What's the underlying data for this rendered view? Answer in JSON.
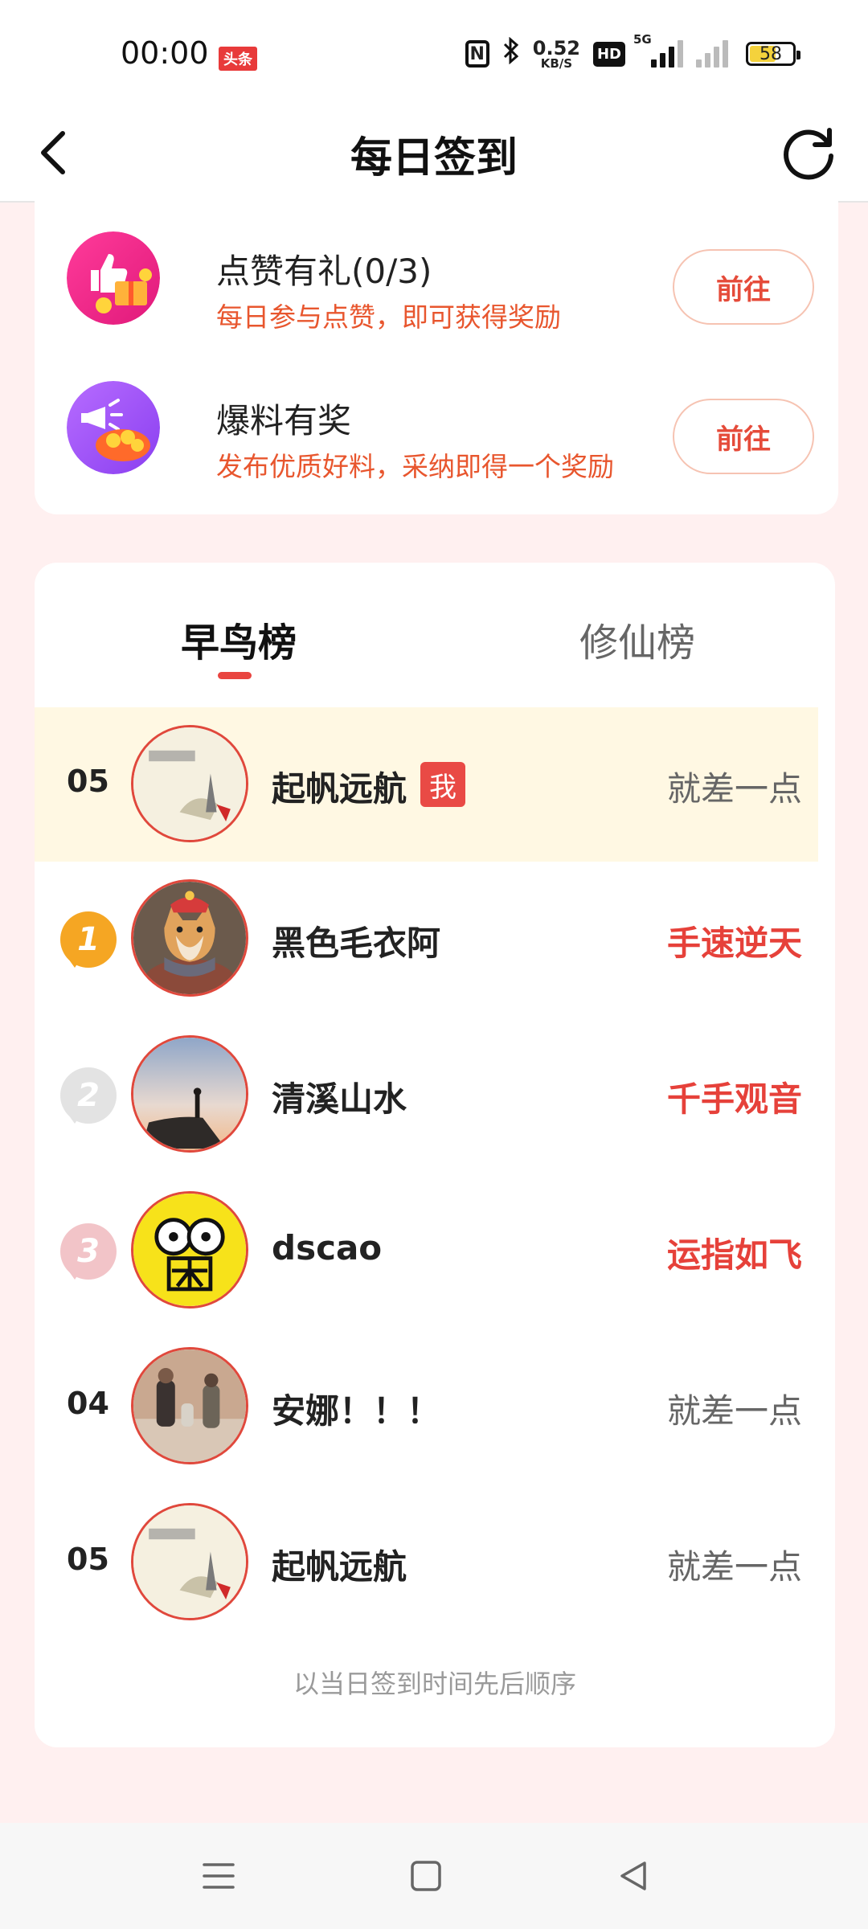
{
  "status_bar": {
    "time": "00:00",
    "news_badge": "头条",
    "nfc": "N",
    "speed_value": "0.52",
    "speed_unit": "KB/S",
    "hd_label": "HD",
    "network": "5G",
    "battery": "58"
  },
  "header": {
    "title": "每日签到"
  },
  "tasks": [
    {
      "title": "点赞有礼(0/3)",
      "desc": "每日参与点赞，即可获得奖励",
      "button": "前往",
      "icon": "like-gift-icon"
    },
    {
      "title": "爆料有奖",
      "desc": "发布优质好料，采纳即得一个奖励",
      "button": "前往",
      "icon": "megaphone-coins-icon"
    }
  ],
  "ranking": {
    "tabs": [
      "早鸟榜",
      "修仙榜"
    ],
    "active_tab": 0,
    "me_badge": "我",
    "rows": [
      {
        "rank": "05",
        "name": "起帆远航",
        "status": "就差一点",
        "is_me": true
      },
      {
        "rank": "1",
        "name": "黑色毛衣阿",
        "status": "手速逆天",
        "medal": "gold"
      },
      {
        "rank": "2",
        "name": "清溪山水",
        "status": "千手观音",
        "medal": "silver"
      },
      {
        "rank": "3",
        "name": "dscao",
        "status": "运指如飞",
        "medal": "bronze"
      },
      {
        "rank": "04",
        "name": "安娜！！！",
        "status": "就差一点"
      },
      {
        "rank": "05",
        "name": "起帆远航",
        "status": "就差一点"
      }
    ],
    "footer_note": "以当日签到时间先后顺序"
  },
  "colors": {
    "accent": "#e94540",
    "orange_text": "#e8562e",
    "gold": "#f5a623",
    "page_bg": "#fff0f0",
    "highlight_row": "#fff8e3"
  }
}
